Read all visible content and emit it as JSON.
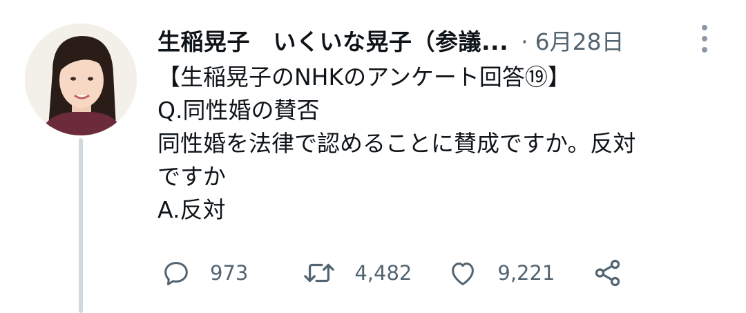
{
  "author": {
    "name": "生稲晃子　いくいな晃子（参議...",
    "separator": "·",
    "date": "6月28日"
  },
  "tweet": {
    "lines": [
      "【生稲晃子のNHKのアンケート回答⑲】",
      "Q.同性婚の賛否",
      "同性婚を法律で認めることに賛成ですか。反対",
      "ですか",
      "A.反対"
    ]
  },
  "actions": {
    "reply_icon": "reply-icon",
    "reply_count": "973",
    "retweet_icon": "retweet-icon",
    "retweet_count": "4,482",
    "like_icon": "heart-icon",
    "like_count": "9,221",
    "share_icon": "share-icon"
  },
  "colors": {
    "text": "#0f1419",
    "secondary": "#536471",
    "thread_line": "#cfd9de"
  }
}
